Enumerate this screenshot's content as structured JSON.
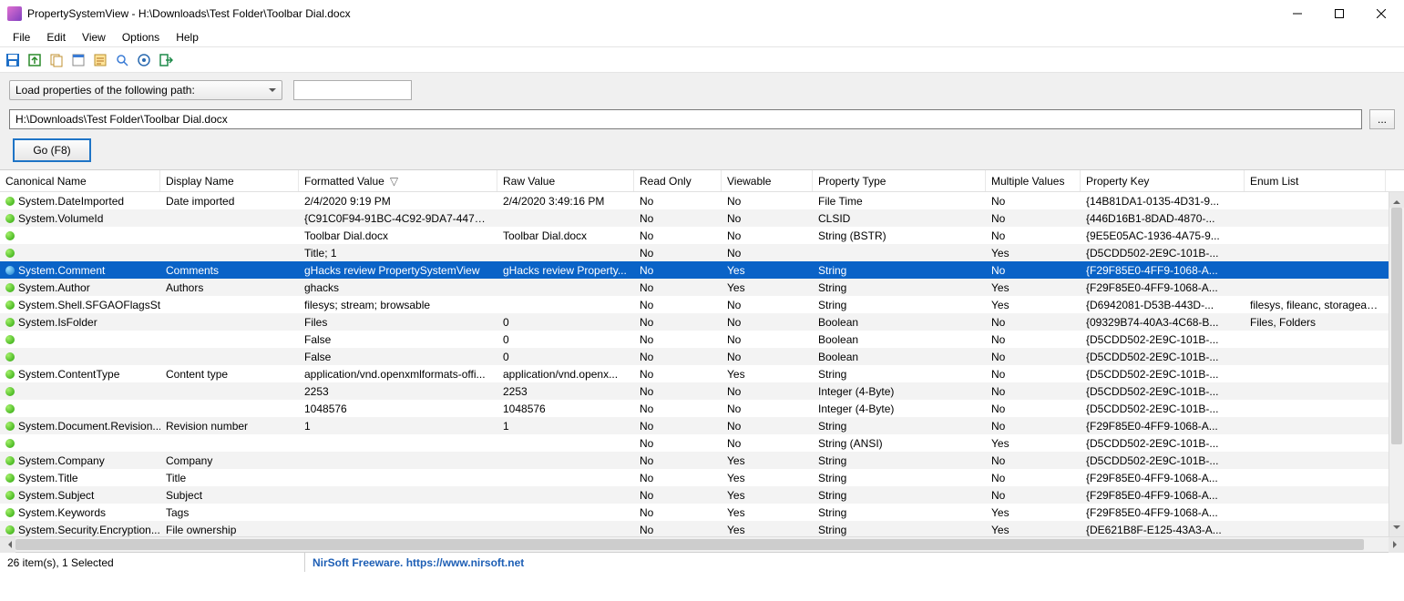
{
  "window": {
    "title": "PropertySystemView  -  H:\\Downloads\\Test Folder\\Toolbar Dial.docx"
  },
  "menu": {
    "items": [
      "File",
      "Edit",
      "View",
      "Options",
      "Help"
    ]
  },
  "controls": {
    "combo_label": "Load properties of the following path:",
    "path_value": "H:\\Downloads\\Test Folder\\Toolbar Dial.docx",
    "browse_label": "...",
    "go_label": "Go (F8)"
  },
  "columns": [
    "Canonical Name",
    "Display Name",
    "Formatted Value",
    "Raw Value",
    "Read Only",
    "Viewable",
    "Property Type",
    "Multiple Values",
    "Property Key",
    "Enum List"
  ],
  "sort_column": 2,
  "rows": [
    {
      "c": [
        "System.DateImported",
        "Date imported",
        "2/4/2020 9:19 PM",
        "2/4/2020 3:49:16 PM",
        "No",
        "No",
        "File Time",
        "No",
        "{14B81DA1-0135-4D31-9...",
        ""
      ]
    },
    {
      "c": [
        "System.VolumeId",
        "",
        "{C91C0F94-91BC-4C92-9DA7-447AFA...",
        "",
        "No",
        "No",
        "CLSID",
        "No",
        "{446D16B1-8DAD-4870-...",
        ""
      ]
    },
    {
      "c": [
        "",
        "",
        "Toolbar Dial.docx",
        "Toolbar Dial.docx",
        "No",
        "No",
        "String (BSTR)",
        "No",
        "{9E5E05AC-1936-4A75-9...",
        ""
      ]
    },
    {
      "c": [
        "",
        "",
        "Title; 1",
        "",
        "No",
        "No",
        "",
        "Yes",
        "{D5CDD502-2E9C-101B-...",
        ""
      ]
    },
    {
      "c": [
        "System.Comment",
        "Comments",
        "gHacks review PropertySystemView",
        "gHacks review Property...",
        "No",
        "Yes",
        "String",
        "No",
        "{F29F85E0-4FF9-1068-A...",
        ""
      ],
      "sel": true
    },
    {
      "c": [
        "System.Author",
        "Authors",
        "ghacks",
        "",
        "No",
        "Yes",
        "String",
        "Yes",
        "{F29F85E0-4FF9-1068-A...",
        ""
      ]
    },
    {
      "c": [
        "System.Shell.SFGAOFlagsStr...",
        "",
        "filesys; stream; browsable",
        "",
        "No",
        "No",
        "String",
        "Yes",
        "{D6942081-D53B-443D-...",
        "filesys, fileanc, storageanc, strear"
      ]
    },
    {
      "c": [
        "System.IsFolder",
        "",
        "Files",
        "0",
        "No",
        "No",
        "Boolean",
        "No",
        "{09329B74-40A3-4C68-B...",
        "Files, Folders"
      ]
    },
    {
      "c": [
        "",
        "",
        "False",
        "0",
        "No",
        "No",
        "Boolean",
        "No",
        "{D5CDD502-2E9C-101B-...",
        ""
      ]
    },
    {
      "c": [
        "",
        "",
        "False",
        "0",
        "No",
        "No",
        "Boolean",
        "No",
        "{D5CDD502-2E9C-101B-...",
        ""
      ]
    },
    {
      "c": [
        "System.ContentType",
        "Content type",
        "application/vnd.openxmlformats-offi...",
        "application/vnd.openx...",
        "No",
        "Yes",
        "String",
        "No",
        "{D5CDD502-2E9C-101B-...",
        ""
      ]
    },
    {
      "c": [
        "",
        "",
        "2253",
        "2253",
        "No",
        "No",
        "Integer (4-Byte)",
        "No",
        "{D5CDD502-2E9C-101B-...",
        ""
      ]
    },
    {
      "c": [
        "",
        "",
        "1048576",
        "1048576",
        "No",
        "No",
        "Integer (4-Byte)",
        "No",
        "{D5CDD502-2E9C-101B-...",
        ""
      ]
    },
    {
      "c": [
        "System.Document.Revision...",
        "Revision number",
        "1",
        "1",
        "No",
        "No",
        "String",
        "No",
        "{F29F85E0-4FF9-1068-A...",
        ""
      ]
    },
    {
      "c": [
        "",
        "",
        "",
        "",
        "No",
        "No",
        "String (ANSI)",
        "Yes",
        "{D5CDD502-2E9C-101B-...",
        ""
      ]
    },
    {
      "c": [
        "System.Company",
        "Company",
        "",
        "",
        "No",
        "Yes",
        "String",
        "No",
        "{D5CDD502-2E9C-101B-...",
        ""
      ]
    },
    {
      "c": [
        "System.Title",
        "Title",
        "",
        "",
        "No",
        "Yes",
        "String",
        "No",
        "{F29F85E0-4FF9-1068-A...",
        ""
      ]
    },
    {
      "c": [
        "System.Subject",
        "Subject",
        "",
        "",
        "No",
        "Yes",
        "String",
        "No",
        "{F29F85E0-4FF9-1068-A...",
        ""
      ]
    },
    {
      "c": [
        "System.Keywords",
        "Tags",
        "",
        "",
        "No",
        "Yes",
        "String",
        "Yes",
        "{F29F85E0-4FF9-1068-A...",
        ""
      ]
    },
    {
      "c": [
        "System.Security.Encryption...",
        "File ownership",
        "",
        "",
        "No",
        "Yes",
        "String",
        "Yes",
        "{DE621B8F-E125-43A3-A...",
        ""
      ]
    }
  ],
  "status": {
    "left": "26 item(s), 1 Selected",
    "right": "NirSoft Freeware. https://www.nirsoft.net"
  },
  "toolbar_icons": [
    "save-icon",
    "export-icon",
    "copy-icon",
    "properties-icon",
    "html-report-icon",
    "find-icon",
    "refresh-icon",
    "exit-icon"
  ]
}
